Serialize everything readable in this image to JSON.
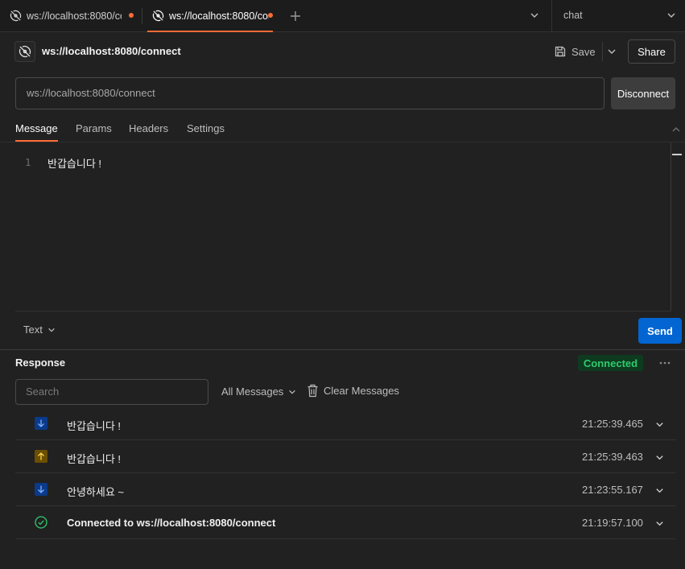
{
  "tabs": [
    {
      "label": "ws://localhost:8080/connect",
      "active": false,
      "unsaved": true
    },
    {
      "label": "ws://localhost:8080/connect",
      "active": true,
      "unsaved": true
    }
  ],
  "environment": {
    "selected": "chat"
  },
  "request": {
    "title": "ws://localhost:8080/connect",
    "save_label": "Save",
    "share_label": "Share",
    "url": "ws://localhost:8080/connect",
    "disconnect_label": "Disconnect"
  },
  "subtabs": [
    {
      "label": "Message",
      "active": true
    },
    {
      "label": "Params",
      "active": false
    },
    {
      "label": "Headers",
      "active": false
    },
    {
      "label": "Settings",
      "active": false
    }
  ],
  "editor": {
    "line_number": "1",
    "content": "반갑습니다 !"
  },
  "composer": {
    "format": "Text",
    "send_label": "Send"
  },
  "response": {
    "title": "Response",
    "status": "Connected",
    "search_placeholder": "Search",
    "filter": "All Messages",
    "clear_label": "Clear Messages",
    "messages": [
      {
        "direction": "incoming",
        "text": "반갑습니다 !",
        "time": "21:25:39.465"
      },
      {
        "direction": "outgoing",
        "text": "반갑습니다 !",
        "time": "21:25:39.463"
      },
      {
        "direction": "incoming",
        "text": "안녕하세요 ~",
        "time": "21:23:55.167"
      },
      {
        "direction": "connected",
        "text": "Connected to ws://localhost:8080/connect",
        "time": "21:19:57.100"
      }
    ]
  },
  "colors": {
    "accent": "#ff6c37",
    "send": "#0265d2",
    "connected_text": "#2fcb6e",
    "connected_bg": "#0e3b1f",
    "incoming_icon_bg": "#0b3a8a",
    "outgoing_icon_bg": "#6b4f00"
  },
  "icons": {
    "ws": "websocket-icon",
    "save": "floppy-disk-icon",
    "trash": "trash-icon",
    "incoming": "arrow-down-icon",
    "outgoing": "arrow-up-icon",
    "connected": "check-circle-icon"
  }
}
